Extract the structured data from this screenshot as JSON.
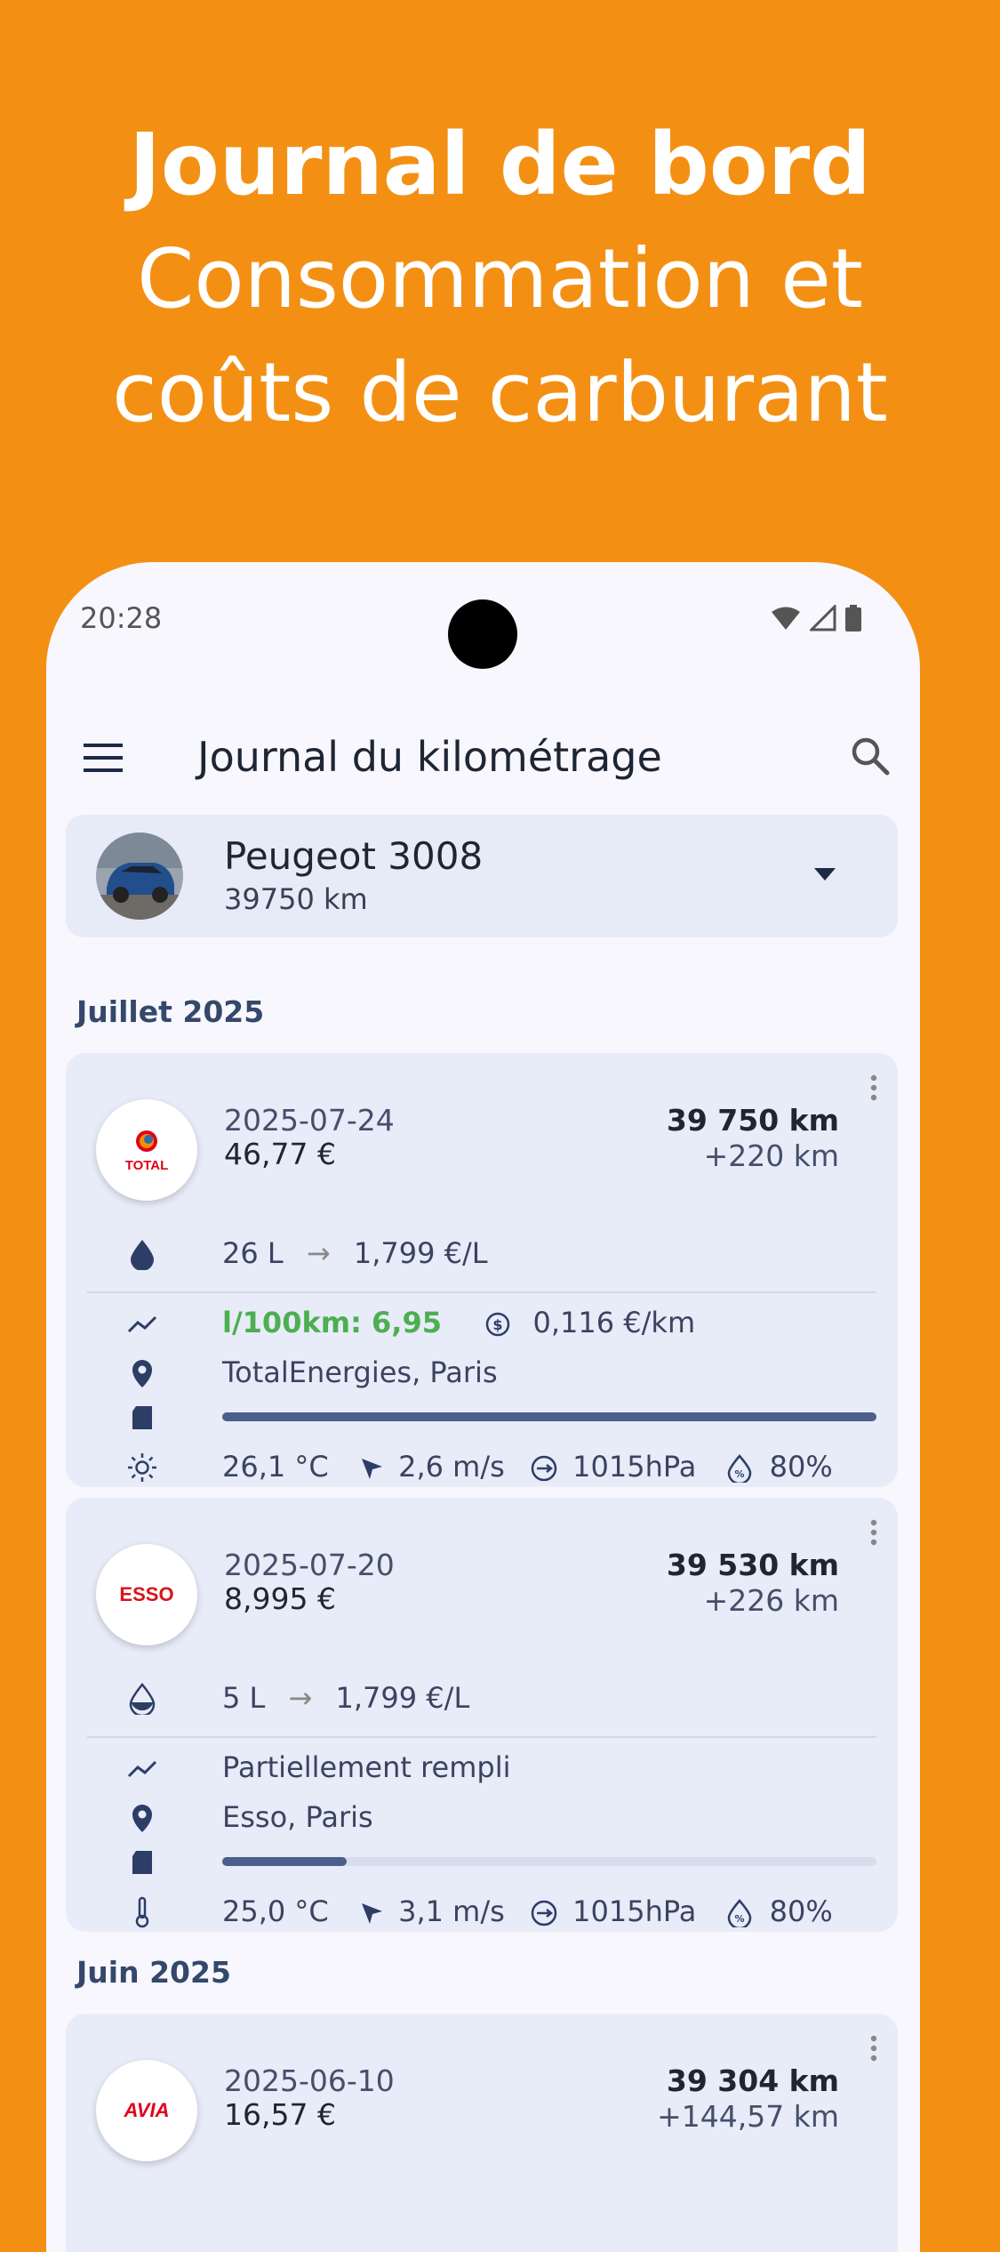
{
  "hero": {
    "title": "Journal de bord",
    "line1": "Consommation et",
    "line2": "coûts de carburant"
  },
  "status_bar": {
    "time": "20:28",
    "icons": [
      "wifi-icon",
      "signal-icon",
      "battery-icon"
    ]
  },
  "app_bar": {
    "title": "Journal du kilométrage",
    "icons": [
      "menu-icon",
      "search-icon"
    ]
  },
  "vehicle": {
    "name": "Peugeot 3008",
    "odometer": "39750 km"
  },
  "sections": [
    {
      "label": "Juillet 2025"
    },
    {
      "label": "Juin 2025"
    }
  ],
  "entries": [
    {
      "brand": "TOTAL",
      "brand_color": "#E2001A",
      "date": "2025-07-24",
      "cost": "46,77 €",
      "odometer": "39 750 km",
      "distance": "+220 km",
      "volume": "26 L",
      "arrow": "→",
      "price": "1,799 €/L",
      "consumption": "l/100km: 6,95",
      "cost_per_km": "0,116 €/km",
      "station": "TotalEnergies, Paris",
      "fill_level": 1.0,
      "temperature": "26,1 °C",
      "wind": "2,6 m/s",
      "pressure": "1015hPa",
      "humidity": "80%"
    },
    {
      "brand": "ESSO",
      "brand_color": "#D7141A",
      "date": "2025-07-20",
      "cost": "8,995 €",
      "odometer": "39 530 km",
      "distance": "+226 km",
      "volume": "5 L",
      "arrow": "→",
      "price": "1,799 €/L",
      "note": "Partiellement rempli",
      "station": "Esso, Paris",
      "fill_level": 0.19,
      "temperature": "25,0 °C",
      "wind": "3,1 m/s",
      "pressure": "1015hPa",
      "humidity": "80%"
    },
    {
      "brand": "AVIA",
      "brand_color": "#E2001A",
      "date": "2025-06-10",
      "cost": "16,57 €",
      "odometer": "39 304 km",
      "distance": "+144,57 km"
    }
  ]
}
